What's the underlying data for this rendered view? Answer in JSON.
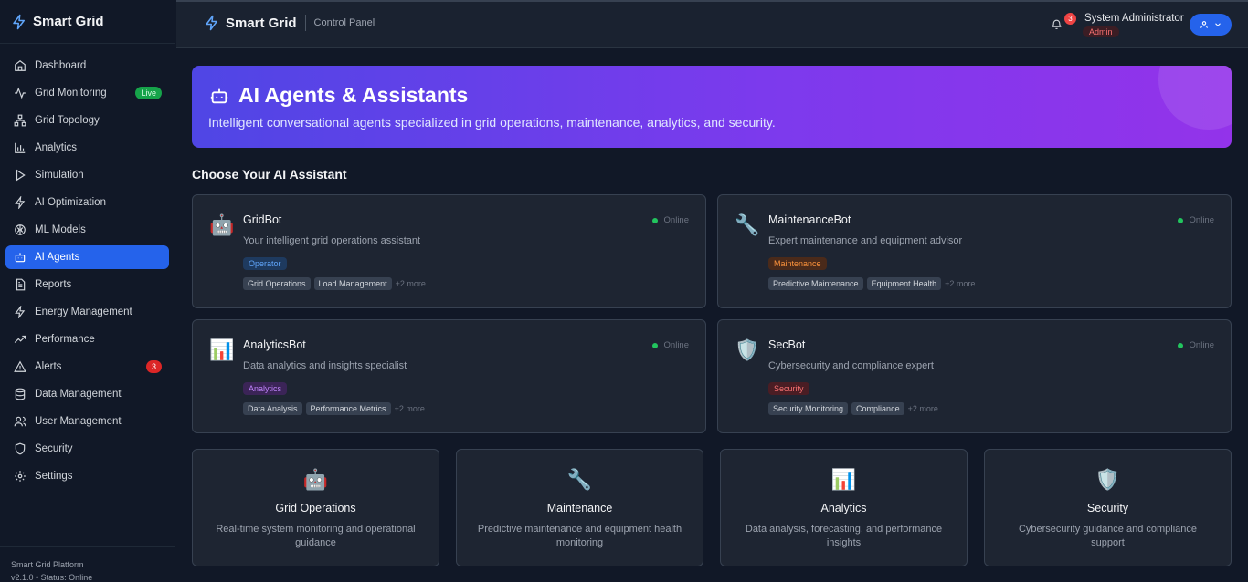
{
  "app": {
    "name": "Smart Grid",
    "section": "Control Panel"
  },
  "sidebar": {
    "items": [
      {
        "label": "Dashboard"
      },
      {
        "label": "Grid Monitoring",
        "badge": "Live"
      },
      {
        "label": "Grid Topology"
      },
      {
        "label": "Analytics"
      },
      {
        "label": "Simulation"
      },
      {
        "label": "AI Optimization"
      },
      {
        "label": "ML Models"
      },
      {
        "label": "AI Agents",
        "active": true
      },
      {
        "label": "Reports"
      },
      {
        "label": "Energy Management"
      },
      {
        "label": "Performance"
      },
      {
        "label": "Alerts",
        "badge": "3"
      },
      {
        "label": "Data Management"
      },
      {
        "label": "User Management"
      },
      {
        "label": "Security"
      },
      {
        "label": "Settings"
      }
    ],
    "footer": {
      "platform": "Smart Grid Platform",
      "version": "v2.1.0 • Status: Online"
    }
  },
  "header": {
    "notification_count": "3",
    "user_name": "System Administrator",
    "user_role": "Admin"
  },
  "hero": {
    "title": "AI Agents & Assistants",
    "subtitle": "Intelligent conversational agents specialized in grid operations, maintenance, analytics, and security."
  },
  "section_title": "Choose Your AI Assistant",
  "agents": [
    {
      "emoji": "🤖",
      "name": "GridBot",
      "description": "Your intelligent grid operations assistant",
      "status": "Online",
      "role": "Operator",
      "role_color": "#60a5fa",
      "role_bg": "#1e3a5f",
      "tags": [
        "Grid Operations",
        "Load Management"
      ],
      "more": "+2 more"
    },
    {
      "emoji": "🔧",
      "name": "MaintenanceBot",
      "description": "Expert maintenance and equipment advisor",
      "status": "Online",
      "role": "Maintenance",
      "role_color": "#fb923c",
      "role_bg": "#4a2a1a",
      "tags": [
        "Predictive Maintenance",
        "Equipment Health"
      ],
      "more": "+2 more"
    },
    {
      "emoji": "📊",
      "name": "AnalyticsBot",
      "description": "Data analytics and insights specialist",
      "status": "Online",
      "role": "Analytics",
      "role_color": "#c084fc",
      "role_bg": "#3b2457",
      "tags": [
        "Data Analysis",
        "Performance Metrics"
      ],
      "more": "+2 more"
    },
    {
      "emoji": "🛡️",
      "name": "SecBot",
      "description": "Cybersecurity and compliance expert",
      "status": "Online",
      "role": "Security",
      "role_color": "#f87171",
      "role_bg": "#4a1d24",
      "tags": [
        "Security Monitoring",
        "Compliance"
      ],
      "more": "+2 more"
    }
  ],
  "features": [
    {
      "emoji": "🤖",
      "title": "Grid Operations",
      "description": "Real-time system monitoring and operational guidance"
    },
    {
      "emoji": "🔧",
      "title": "Maintenance",
      "description": "Predictive maintenance and equipment health monitoring"
    },
    {
      "emoji": "📊",
      "title": "Analytics",
      "description": "Data analysis, forecasting, and performance insights"
    },
    {
      "emoji": "🛡️",
      "title": "Security",
      "description": "Cybersecurity guidance and compliance support"
    }
  ],
  "colors": {
    "accent": "#2563eb",
    "online": "#22c55e",
    "hero_start": "#4f46e5",
    "hero_end": "#9333ea"
  }
}
